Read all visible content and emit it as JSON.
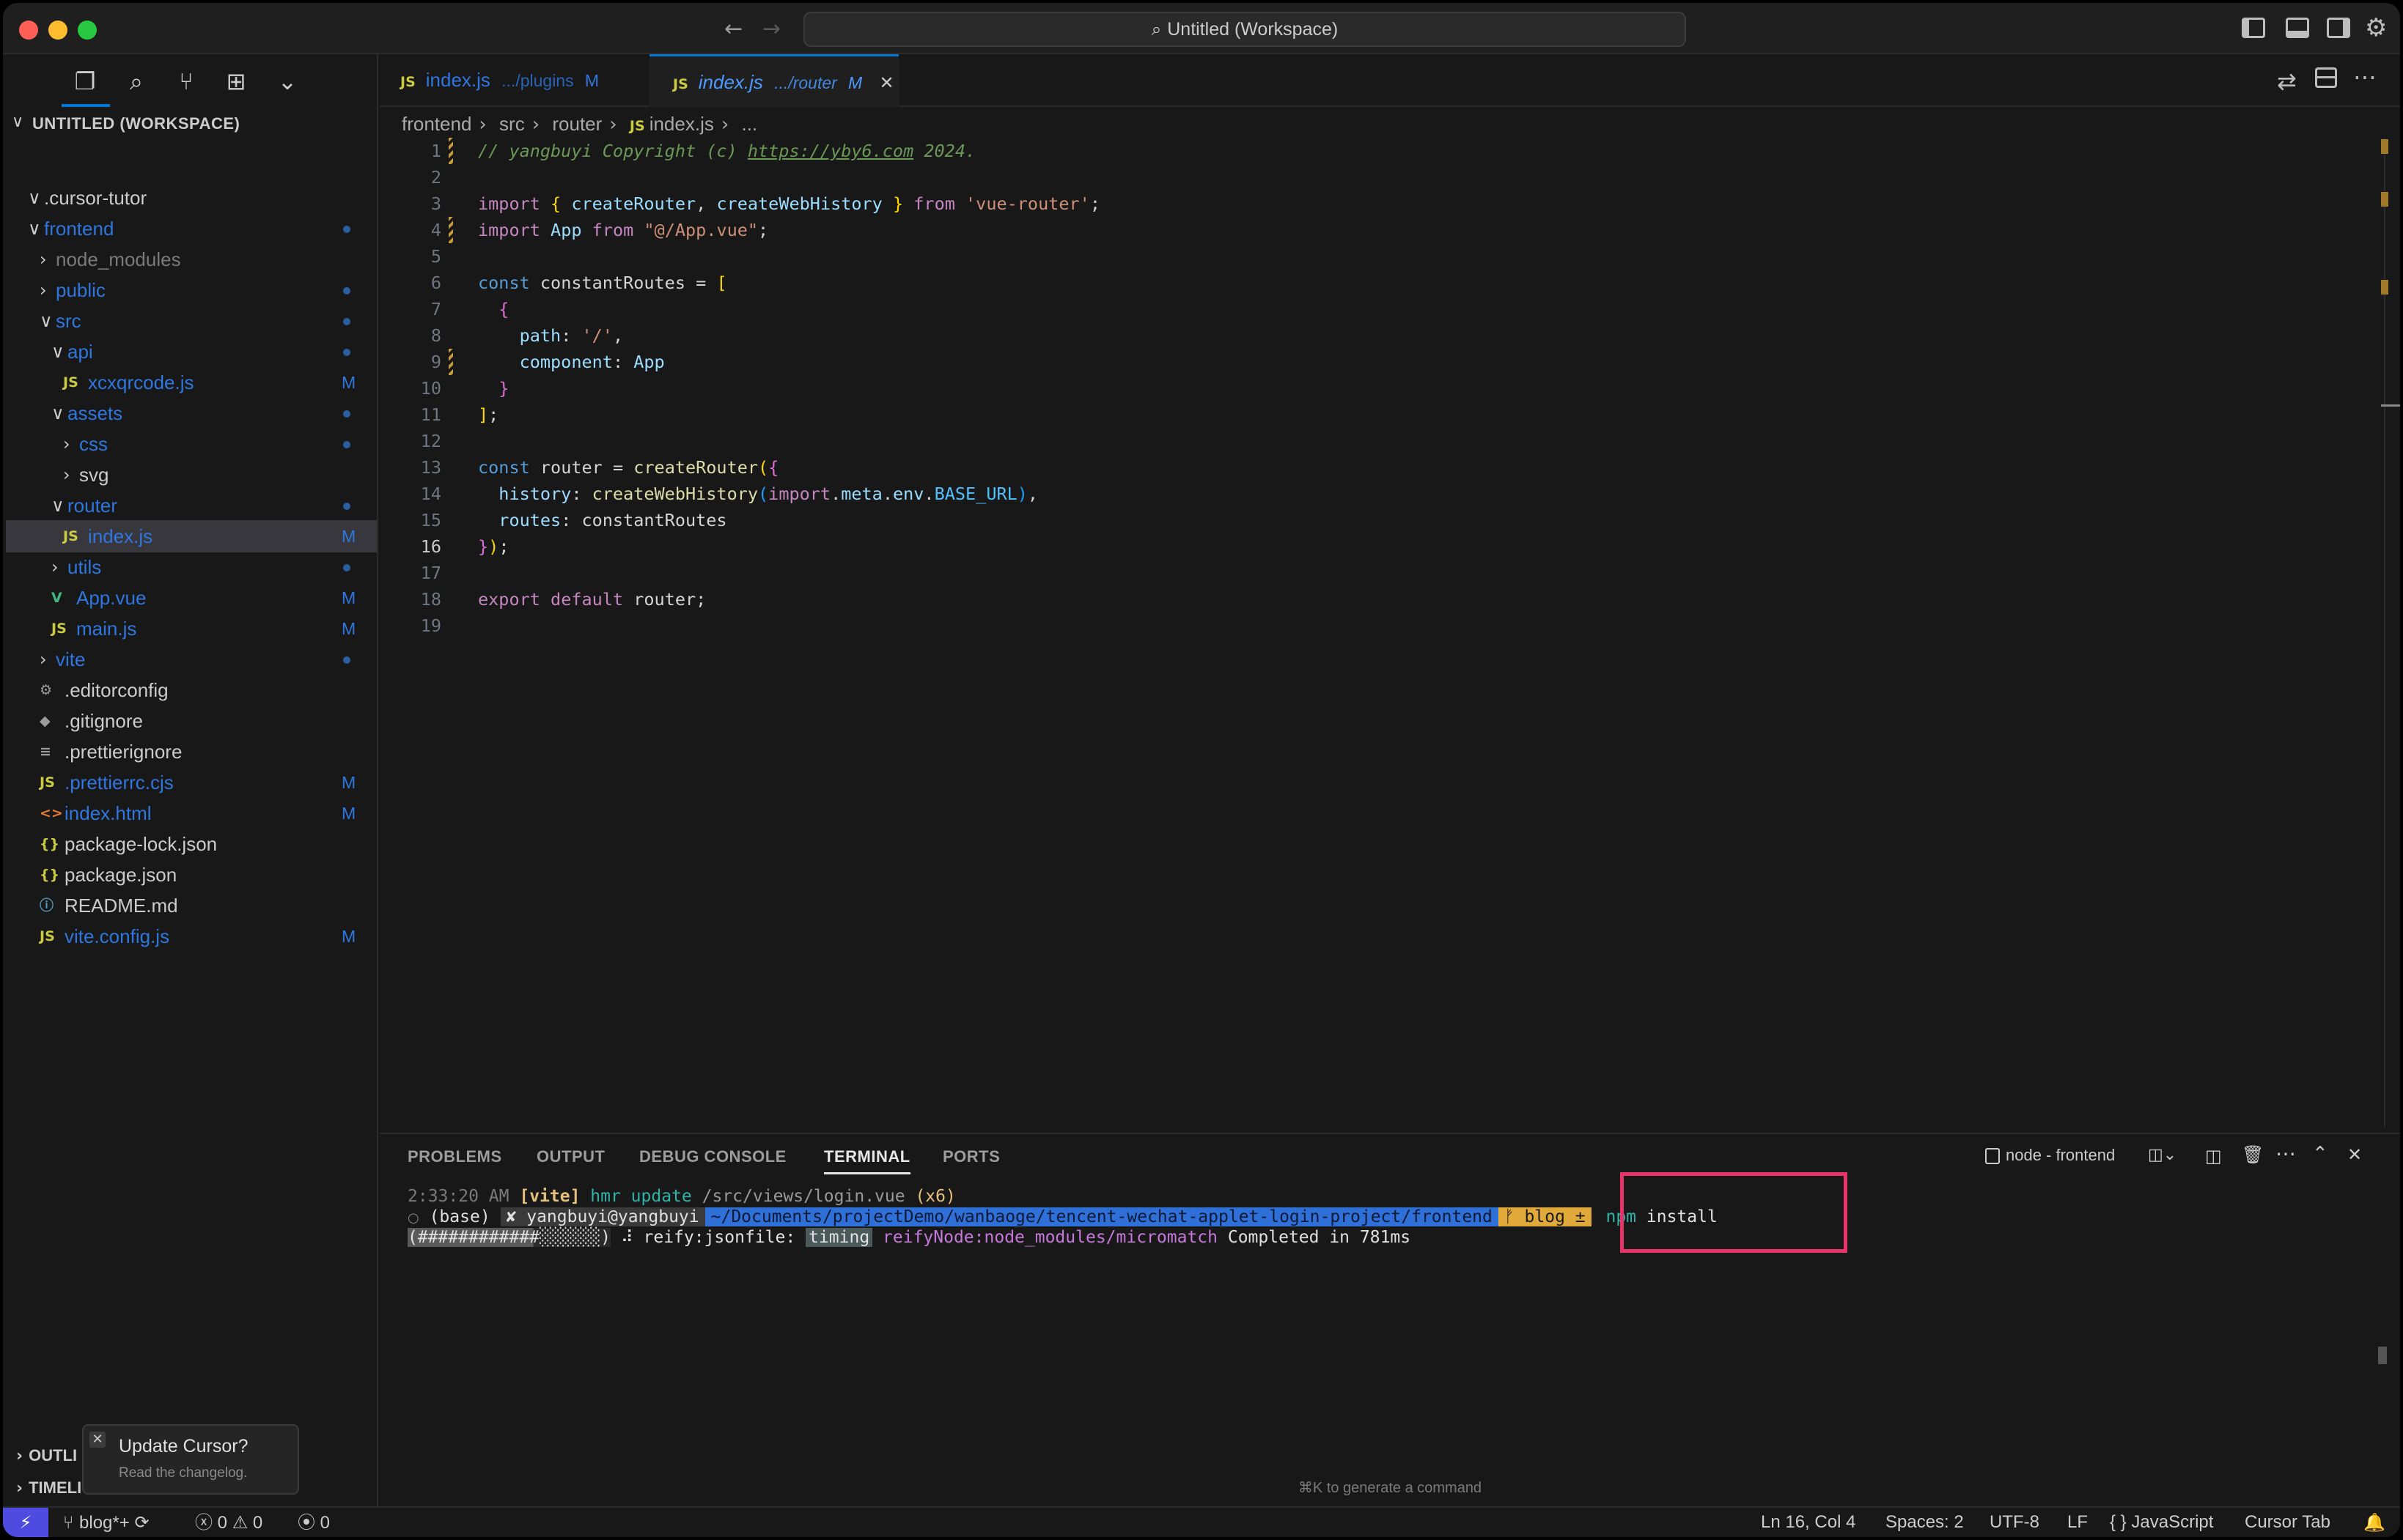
{
  "window": {
    "title": "Untitled (Workspace)",
    "search_icon": "search-icon"
  },
  "sidebar": {
    "workspace_title": "UNTITLED (WORKSPACE)",
    "tree": [
      {
        "label": ".cursor-tutor",
        "chev": "∨",
        "icon": "",
        "badge": "",
        "dot": false,
        "color": "white"
      },
      {
        "label": "frontend",
        "chev": "∨",
        "icon": "",
        "badge": "",
        "dot": true,
        "color": "blue"
      },
      {
        "label": "node_modules",
        "chev": "›",
        "icon": "",
        "badge": "",
        "dot": false,
        "color": "gray"
      },
      {
        "label": "public",
        "chev": "›",
        "icon": "",
        "badge": "",
        "dot": true,
        "color": "blue"
      },
      {
        "label": "src",
        "chev": "∨",
        "icon": "",
        "badge": "",
        "dot": true,
        "color": "blue"
      },
      {
        "label": "api",
        "chev": "∨",
        "icon": "",
        "badge": "",
        "dot": true,
        "color": "blue"
      },
      {
        "label": "xcxqrcode.js",
        "chev": "",
        "icon": "JS",
        "badge": "M",
        "dot": false,
        "color": "blue"
      },
      {
        "label": "assets",
        "chev": "∨",
        "icon": "",
        "badge": "",
        "dot": true,
        "color": "blue"
      },
      {
        "label": "css",
        "chev": "›",
        "icon": "",
        "badge": "",
        "dot": true,
        "color": "blue"
      },
      {
        "label": "svg",
        "chev": "›",
        "icon": "",
        "badge": "",
        "dot": false,
        "color": "white"
      },
      {
        "label": "router",
        "chev": "∨",
        "icon": "",
        "badge": "",
        "dot": true,
        "color": "blue"
      },
      {
        "label": "index.js",
        "chev": "",
        "icon": "JS",
        "badge": "M",
        "dot": false,
        "color": "blue",
        "selected": true
      },
      {
        "label": "utils",
        "chev": "›",
        "icon": "",
        "badge": "",
        "dot": true,
        "color": "blue"
      },
      {
        "label": "App.vue",
        "chev": "",
        "icon": "V",
        "badge": "M",
        "dot": false,
        "color": "blue"
      },
      {
        "label": "main.js",
        "chev": "",
        "icon": "JS",
        "badge": "M",
        "dot": false,
        "color": "blue"
      },
      {
        "label": "vite",
        "chev": "›",
        "icon": "",
        "badge": "",
        "dot": true,
        "color": "blue"
      },
      {
        "label": ".editorconfig",
        "chev": "",
        "icon": "⚙",
        "badge": "",
        "dot": false,
        "color": "white"
      },
      {
        "label": ".gitignore",
        "chev": "",
        "icon": "◆",
        "badge": "",
        "dot": false,
        "color": "white"
      },
      {
        "label": ".prettierignore",
        "chev": "",
        "icon": "≡",
        "badge": "",
        "dot": false,
        "color": "white"
      },
      {
        "label": ".prettierrc.cjs",
        "chev": "",
        "icon": "JS",
        "badge": "M",
        "dot": false,
        "color": "blue"
      },
      {
        "label": "index.html",
        "chev": "",
        "icon": "<>",
        "badge": "M",
        "dot": false,
        "color": "blue"
      },
      {
        "label": "package-lock.json",
        "chev": "",
        "icon": "{}",
        "badge": "",
        "dot": false,
        "color": "white"
      },
      {
        "label": "package.json",
        "chev": "",
        "icon": "{}",
        "badge": "",
        "dot": false,
        "color": "white"
      },
      {
        "label": "README.md",
        "chev": "",
        "icon": "ⓘ",
        "badge": "",
        "dot": false,
        "color": "white"
      },
      {
        "label": "vite.config.js",
        "chev": "",
        "icon": "JS",
        "badge": "M",
        "dot": false,
        "color": "blue"
      }
    ],
    "outline_label": "OUTLI",
    "timeline_label": "TIMELI",
    "toast": {
      "title": "Update Cursor?",
      "subtitle": "Read the changelog."
    }
  },
  "tabs": [
    {
      "name": "index.js",
      "path": ".../plugins",
      "badge": "M"
    },
    {
      "name": "index.js",
      "path": ".../router",
      "badge": "M"
    }
  ],
  "breadcrumb": {
    "a": "frontend",
    "b": "src",
    "c": "router",
    "d": "index.js",
    "e": "..."
  },
  "editor": {
    "current_line": 16,
    "lines": [
      {
        "n": "1"
      },
      {
        "n": "2"
      },
      {
        "n": "3"
      },
      {
        "n": "4"
      },
      {
        "n": "5"
      },
      {
        "n": "6"
      },
      {
        "n": "7"
      },
      {
        "n": "8"
      },
      {
        "n": "9"
      },
      {
        "n": "10"
      },
      {
        "n": "11"
      },
      {
        "n": "12"
      },
      {
        "n": "13"
      },
      {
        "n": "14"
      },
      {
        "n": "15"
      },
      {
        "n": "16"
      },
      {
        "n": "17"
      },
      {
        "n": "18"
      },
      {
        "n": "19"
      }
    ],
    "code": {
      "l1_comment": "// yangbuyi Copyright (c) ",
      "l1_link": "https://yby6.com",
      "l1_tail": " 2024.",
      "import": "import",
      "from": "from",
      "createRouter": "createRouter",
      "createWebHistory": "createWebHistory",
      "vue_router": "'vue-router'",
      "App": "App",
      "app_path": "\"@/App.vue\"",
      "const": "const",
      "constantRoutes": "constantRoutes",
      "path": "path",
      "slash": "'/'",
      "component": "component",
      "router": "router",
      "history": "history",
      "meta_expr_a": "import",
      "meta_expr_b": "meta",
      "meta_expr_c": "env",
      "meta_expr_d": "BASE_URL",
      "routes": "routes",
      "export": "export",
      "default": "default"
    }
  },
  "panel": {
    "tabs": [
      "PROBLEMS",
      "OUTPUT",
      "DEBUG CONSOLE",
      "TERMINAL",
      "PORTS"
    ],
    "active_tab": "TERMINAL",
    "terminal_name": "node - frontend",
    "terminal": {
      "l1_time": "2:33:20 AM",
      "l1_vite": "[vite]",
      "l1_msg": "hmr update",
      "l1_path": "/src/views/login.vue",
      "l1_count": "(x6)",
      "l2_base": "(base)",
      "l2_user": "✘ yangbuyi@yangbuyi",
      "l2_path": "~/Documents/projectDemo/wanbaoge/tencent-wechat-applet-login-project/frontend",
      "l2_branch": "ᚠ blog ±",
      "l2_cmd1": "npm",
      "l2_cmd2": "install",
      "l3_progress": "(############░░░░░░)",
      "l3_msg": "⠼ reify:jsonfile:",
      "l3_timing": "timing",
      "l3_node": "reifyNode:node_modules/micromatch",
      "l3_done": "Completed in 781ms"
    },
    "hint": "⌘K to generate a command"
  },
  "status": {
    "branch": "blog*+",
    "errors": "0",
    "warnings": "0",
    "ports": "0",
    "position": "Ln 16, Col 4",
    "spaces": "Spaces: 2",
    "encoding": "UTF-8",
    "eol": "LF",
    "language": "JavaScript",
    "cursor_tab": "Cursor Tab"
  },
  "colors": {
    "accent": "#0078d4",
    "highlight_box": "#e8336b",
    "modified": "#2f77e0"
  }
}
